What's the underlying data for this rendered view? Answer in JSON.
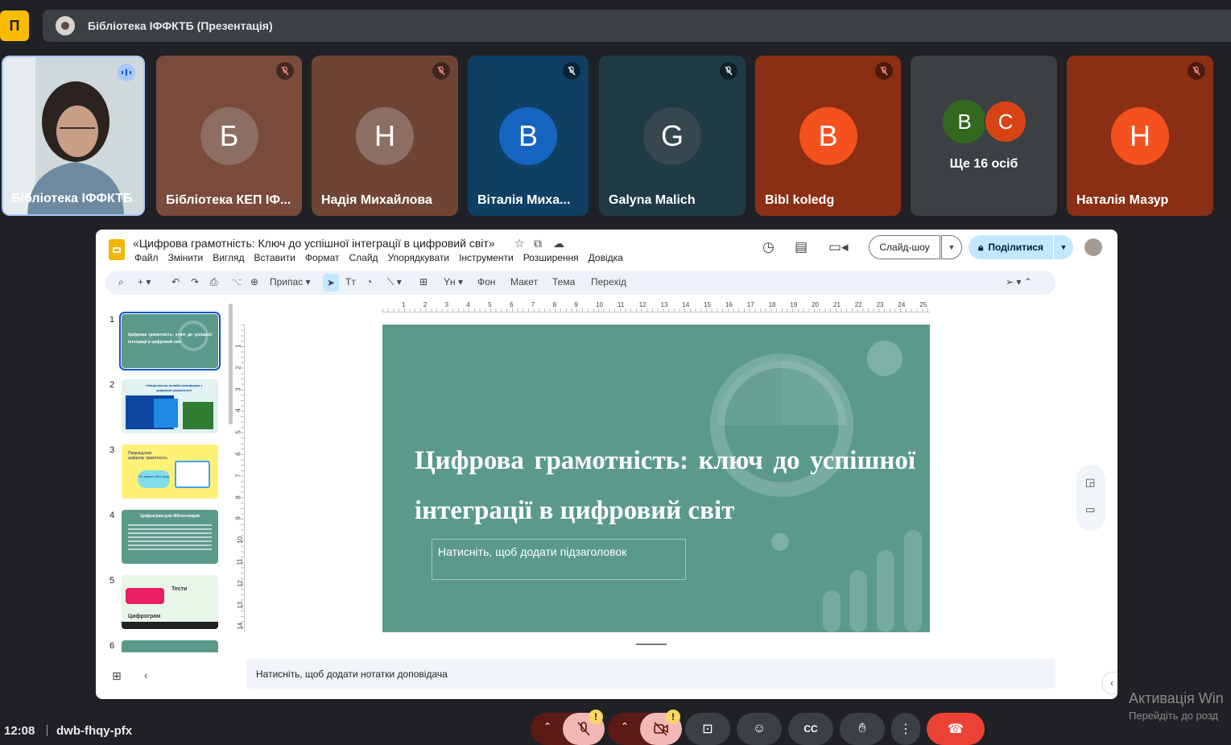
{
  "meet": {
    "logo_glyph": "П",
    "presentation_title": "Бібліотека ІФФКТБ (Презентація)",
    "participants": [
      {
        "name": "Бібліотека ІФФКТБ",
        "initial": "",
        "type": "video",
        "speaking": true
      },
      {
        "name": "Бібліотека КЕП ІФ...",
        "initial": "Б",
        "muted": true,
        "bg": "#7a4a3a",
        "avatar_color": "#8d6e63"
      },
      {
        "name": "Надія Михайлова",
        "initial": "Н",
        "muted": true,
        "bg": "#6e4535",
        "avatar_color": "#8d6e63"
      },
      {
        "name": "Віталія Миха...",
        "initial": "В",
        "muted": true,
        "bg": "#0f3f63",
        "avatar_color": "#1565c0"
      },
      {
        "name": "Galyna Malich",
        "initial": "G",
        "muted": true,
        "bg": "#1f3b45",
        "avatar_color": "#37474f"
      },
      {
        "name": "Bibl koledg",
        "initial": "В",
        "muted": true,
        "bg": "#8a2f14",
        "avatar_color": "#f4511e"
      },
      {
        "name": "Наталія Мазур",
        "initial": "Н",
        "muted": true,
        "bg": "#8a2f14",
        "avatar_color": "#f4511e"
      }
    ],
    "more_tile": {
      "label": "Ще 16 осіб",
      "initials": [
        "В",
        "С"
      ]
    },
    "clock": "12:08",
    "meeting_code": "dwb-fhqy-pfx",
    "warning_glyph": "!"
  },
  "slides_app": {
    "doc_title": "«Цифрова грамотність: Ключ до успішної інтеграції в цифровий світ»",
    "menu": [
      "Файл",
      "Змінити",
      "Вигляд",
      "Вставити",
      "Формат",
      "Слайд",
      "Упорядкувати",
      "Інструменти",
      "Розширення",
      "Довідка"
    ],
    "slideshow_label": "Слайд-шоу",
    "share_label": "Поділитися",
    "toolbar": {
      "fit_label": "Припас",
      "background_label": "Фон",
      "layout_label": "Макет",
      "theme_label": "Тема",
      "transition_label": "Перехід"
    },
    "ruler_h": [
      "1",
      "2",
      "3",
      "4",
      "5",
      "6",
      "7",
      "8",
      "9",
      "10",
      "11",
      "12",
      "13",
      "14",
      "15",
      "16",
      "17",
      "18",
      "19",
      "20",
      "21",
      "22",
      "23",
      "24",
      "25"
    ],
    "ruler_v": [
      "1",
      "2",
      "3",
      "4",
      "5",
      "6",
      "7",
      "8",
      "9",
      "10",
      "11",
      "12",
      "13",
      "14"
    ],
    "thumbnails": [
      {
        "num": "1",
        "text": "Цифрова грамотність: ключ до успішної інтеграції в цифровий світ"
      },
      {
        "num": "2",
        "text": "«Національна онлайн-платформа з цифрової грамотності"
      },
      {
        "num": "3",
        "text": "Покращуємо цифрову грамотність",
        "date": "19 червня 2024 року"
      },
      {
        "num": "4",
        "text": "Цифрограм для бібліотекарів"
      },
      {
        "num": "5",
        "text": "Тести",
        "text2": "Цифрограм"
      },
      {
        "num": "6",
        "text": ""
      }
    ],
    "slide": {
      "title": "Цифрова грамотність: ключ до успішної інтеграції в цифровий світ",
      "subtitle_placeholder": "Натисніть, щоб додати підзаголовок"
    },
    "notes_placeholder": "Натисніть, щоб додати нотатки доповідача"
  },
  "windows": {
    "activation_title": "Активація Win",
    "activation_sub": "Перейдіть до розд"
  },
  "colors": {
    "slide_bg": "#5b9a8b",
    "meet_bg": "#202124",
    "share_bg": "#c2e7ff",
    "end_call": "#ea4335"
  }
}
